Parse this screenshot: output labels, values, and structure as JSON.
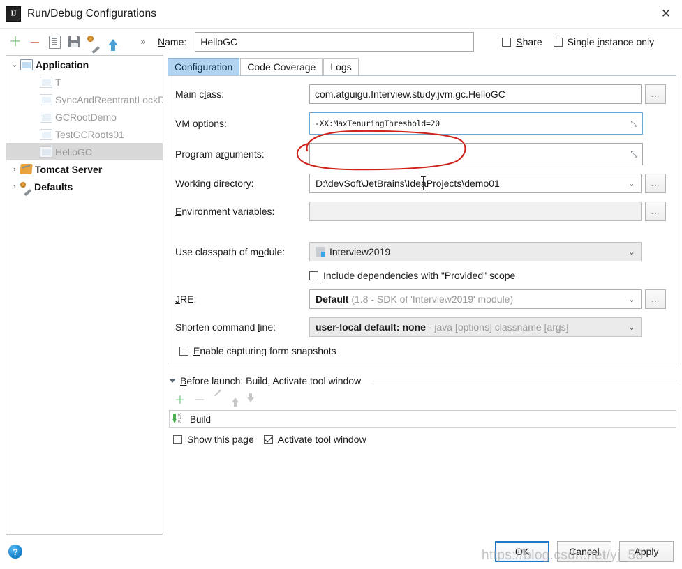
{
  "window": {
    "title": "Run/Debug Configurations",
    "logo_text": "IJ",
    "close_label": "✕"
  },
  "toolbar": {
    "icons": [
      {
        "name": "add-icon",
        "glyph": "+"
      },
      {
        "name": "remove-icon",
        "glyph": "−"
      },
      {
        "name": "copy-configuration-icon",
        "glyph": ""
      },
      {
        "name": "save-configuration-icon",
        "glyph": ""
      },
      {
        "name": "edit-defaults-icon",
        "glyph": ""
      },
      {
        "name": "move-up-icon",
        "glyph": ""
      },
      {
        "name": "more-options-icon",
        "glyph": "»"
      }
    ]
  },
  "name_row": {
    "label": "Name:",
    "label_mnemonic": "N",
    "label_rest": "ame:",
    "value": "HelloGC",
    "placeholder": "",
    "share": {
      "label_mnemonic": "S",
      "label_rest": "hare",
      "checked": false
    },
    "single_instance": {
      "label_pre": "Single ",
      "label_mnemonic": "i",
      "label_rest": "nstance only",
      "checked": false
    }
  },
  "tree": {
    "nodes": [
      {
        "label": "Application",
        "arrow": "⌄",
        "icon": "application-folder-icon",
        "level": 0,
        "bold": true,
        "selected": false,
        "dim": false
      },
      {
        "label": "T",
        "arrow": "",
        "icon": "application-run-icon",
        "level": 1,
        "bold": false,
        "selected": false,
        "dim": true
      },
      {
        "label": "SyncAndReentrantLockD",
        "arrow": "",
        "icon": "application-run-icon",
        "level": 1,
        "bold": false,
        "selected": false,
        "dim": true
      },
      {
        "label": "GCRootDemo",
        "arrow": "",
        "icon": "application-run-icon",
        "level": 1,
        "bold": false,
        "selected": false,
        "dim": true
      },
      {
        "label": "TestGCRoots01",
        "arrow": "",
        "icon": "application-run-icon",
        "level": 1,
        "bold": false,
        "selected": false,
        "dim": true
      },
      {
        "label": "HelloGC",
        "arrow": "",
        "icon": "application-run-icon",
        "level": 1,
        "bold": false,
        "selected": true,
        "dim": true
      },
      {
        "label": "Tomcat Server",
        "arrow": "›",
        "icon": "tomcat-icon",
        "level": 0,
        "bold": true,
        "selected": false,
        "dim": false
      },
      {
        "label": "Defaults",
        "arrow": "›",
        "icon": "defaults-wrench-icon",
        "level": 0,
        "bold": true,
        "selected": false,
        "dim": false
      }
    ]
  },
  "tabs": [
    {
      "label": "Configuration",
      "active": true
    },
    {
      "label": "Code Coverage",
      "active": false
    },
    {
      "label": "Logs",
      "active": false
    }
  ],
  "form": {
    "main_class": {
      "label_pre": "Main c",
      "label_mnemonic": "l",
      "label_rest": "ass:",
      "value": "com.atguigu.Interview.study.jvm.gc.HelloGC",
      "browse": "…"
    },
    "vm_options": {
      "label_mnemonic": "V",
      "label_rest": "M options:",
      "value": "-XX:MaxTenuringThreshold=20",
      "expand": "⤡"
    },
    "program_arguments": {
      "label_pre": "Program a",
      "label_mnemonic": "r",
      "label_rest": "guments:",
      "value": "",
      "expand": "⤡"
    },
    "working_directory": {
      "label_mnemonic": "W",
      "label_rest": "orking directory:",
      "value": "D:\\devSoft\\JetBrains\\IdeaProjects\\demo01",
      "arrow": "⌄",
      "browse": "…"
    },
    "environment_variables": {
      "label_mnemonic": "E",
      "label_rest": "nvironment variables:",
      "value": "",
      "browse": "…"
    },
    "use_classpath_of_module": {
      "label_pre": "Use classpath of m",
      "label_mnemonic": "o",
      "label_rest": "dule:",
      "value": "Interview2019",
      "arrow": "⌄"
    },
    "include_provided": {
      "label_mnemonic": "I",
      "label_rest": "nclude dependencies with \"Provided\" scope",
      "checked": false
    },
    "jre": {
      "label_pre": "",
      "label_mnemonic": "J",
      "label_rest": "RE:",
      "value_strong": "Default",
      "value_dim": " (1.8 - SDK of 'Interview2019' module)",
      "arrow": "⌄",
      "browse": "…"
    },
    "shorten_command_line": {
      "label_pre": "Shorten command ",
      "label_mnemonic": "l",
      "label_rest": "ine:",
      "value_strong": "user-local default: none",
      "value_dim": " - java [options] classname [args]",
      "arrow": "⌄"
    },
    "enable_capturing": {
      "label_mnemonic": "E",
      "label_rest": "nable capturing form snapshots",
      "checked": false
    }
  },
  "before_launch": {
    "header_mnemonic": "B",
    "header_rest": "efore launch: Build, Activate tool window",
    "tools": [
      {
        "name": "bl-add-icon",
        "glyph": "+"
      },
      {
        "name": "bl-remove-icon",
        "glyph": "−"
      },
      {
        "name": "bl-edit-icon",
        "glyph": ""
      },
      {
        "name": "bl-move-up-icon",
        "glyph": ""
      },
      {
        "name": "bl-move-down-icon",
        "glyph": ""
      }
    ],
    "items": [
      {
        "label": "Build",
        "icon": "build-compile-icon",
        "bits": "01\n10\n01"
      }
    ],
    "show_this_page": {
      "label": "Show this page",
      "checked": false
    },
    "activate_tool_window": {
      "label": "Activate tool window",
      "checked": true
    }
  },
  "footer": {
    "help_glyph": "?",
    "buttons": [
      {
        "label": "OK",
        "default": true
      },
      {
        "label": "Cancel",
        "default": false
      },
      {
        "label": "Apply",
        "default": false
      }
    ]
  },
  "overlay": {
    "watermark": "https://blog.csdn.net/yj_58",
    "annotation": "red-ellipse-around-vm-options"
  },
  "colors": {
    "accent_tab": "#b3d4f0",
    "default_button_border": "#1f78c8",
    "add_icon_green": "#4caf50",
    "remove_icon_red": "#d8624d",
    "annotation_red": "#d0231b",
    "selection_grey": "#d8d8d8"
  }
}
